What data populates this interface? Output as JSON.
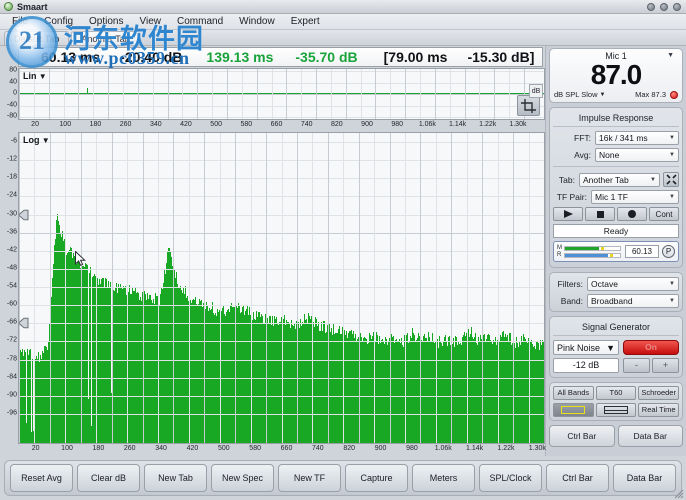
{
  "window": {
    "title": "Smaart",
    "controls": [
      "minimize",
      "maximize",
      "close"
    ]
  },
  "menubar": {
    "items": [
      "File",
      "Config",
      "Options",
      "View",
      "Command",
      "Window",
      "Expert"
    ]
  },
  "tabs": [
    {
      "label": "Default Tab",
      "active": false
    },
    {
      "label": "Another Tab",
      "active": true
    }
  ],
  "watermark": {
    "cn_text": "河东软件园",
    "url_text": "www.pc0359.cn",
    "logo_text": "21"
  },
  "readout": {
    "values": [
      {
        "text": "60.13 ms",
        "color": "#101216"
      },
      {
        "text": "-20.40 dB",
        "color": "#101216"
      },
      {
        "text": "139.13 ms",
        "color": "#19a33a"
      },
      {
        "text": "-35.70 dB",
        "color": "#19a33a"
      },
      {
        "text": "[79.00 ms",
        "color": "#101216"
      },
      {
        "text": "-15.30 dB]",
        "color": "#101216"
      }
    ]
  },
  "chart_data": [
    {
      "type": "line",
      "name": "impulse-response-linear",
      "title": "Lin",
      "xlabel": "",
      "ylabel": "",
      "ylim": [
        -80,
        80
      ],
      "yticks": [
        80,
        40,
        0,
        -40,
        -80
      ],
      "xticks": [
        "20",
        "100",
        "180",
        "260",
        "340",
        "420",
        "500",
        "580",
        "660",
        "740",
        "820",
        "900",
        "980",
        "1.06k",
        "1.14k",
        "1.22k",
        "1.30k"
      ],
      "grid": true,
      "trace_color": "#16a32f",
      "axis_unit_label": "dB",
      "values_note": "flat trace at 0 with small cursor tick near left"
    },
    {
      "type": "bar",
      "name": "spectrum-log",
      "title": "Log",
      "xlabel": "",
      "ylabel": "dB",
      "ylim": [
        -99,
        -3
      ],
      "yticks": [
        -6,
        -12,
        -18,
        -24,
        -30,
        -36,
        -42,
        -48,
        -54,
        -60,
        -66,
        -72,
        -78,
        -84,
        -90,
        -96
      ],
      "xticks": [
        "20",
        "100",
        "180",
        "260",
        "340",
        "420",
        "500",
        "580",
        "660",
        "740",
        "820",
        "900",
        "980",
        "1.06k",
        "1.14k",
        "1.22k",
        "1.30k"
      ],
      "grid": true,
      "bar_color": "#19a823",
      "markers": [
        -30,
        -66
      ],
      "categories": [
        "20",
        "28",
        "36",
        "44",
        "52",
        "60",
        "68",
        "76",
        "84",
        "92",
        "100",
        "108",
        "116",
        "124",
        "132",
        "140",
        "148",
        "156",
        "164",
        "172",
        "180",
        "188",
        "196",
        "204",
        "212",
        "220",
        "228",
        "236",
        "244",
        "252",
        "260",
        "300",
        "340",
        "380",
        "420",
        "460",
        "500",
        "540",
        "580",
        "620",
        "660",
        "700",
        "740",
        "780",
        "820",
        "860",
        "900",
        "940",
        "980",
        "1020",
        "1060",
        "1100",
        "1140",
        "1180",
        "1220",
        "1260",
        "1300"
      ],
      "values": [
        -70,
        -69,
        -71,
        -68,
        -24,
        -35,
        -38,
        -41,
        -44,
        -46,
        -47,
        -49,
        -48,
        -50,
        -51,
        -52,
        -34,
        -47,
        -50,
        -53,
        -54,
        -55,
        -56,
        -54,
        -55,
        -57,
        -58,
        -59,
        -58,
        -60,
        -59,
        -58,
        -60,
        -61,
        -62,
        -63,
        -64,
        -65,
        -64,
        -66,
        -65,
        -66,
        -63,
        -65,
        -64,
        -66,
        -65,
        -66,
        -62,
        -65,
        -64,
        -66,
        -63,
        -66,
        -65,
        -66,
        -67
      ]
    }
  ],
  "spl_meter": {
    "source": "Mic 1",
    "value": "87.0",
    "weighting": "dB SPL Slow",
    "max_label": "Max",
    "max_value": "87.3",
    "led_color": "#d91414"
  },
  "impulse_response": {
    "title": "Impulse Response",
    "fft_label": "FFT:",
    "fft_value": "16k / 341 ms",
    "avg_label": "Avg:",
    "avg_value": "None",
    "tab_label": "Tab:",
    "tab_value": "Another Tab",
    "tools_icon": "wrench-icon",
    "tf_pair_label": "TF Pair:",
    "tf_pair_value": "Mic 1 TF",
    "transport": [
      "play-icon",
      "stop-icon",
      "record-icon",
      "Cont"
    ],
    "status": "Ready",
    "meters": [
      {
        "name": "M",
        "level": 62,
        "peak": 66,
        "color": "#1ea52a"
      },
      {
        "name": "R",
        "level": 78,
        "peak": 82,
        "color": "#4f8fd6"
      }
    ],
    "delay_value": "60.13",
    "peak_button": "P",
    "filters_label": "Filters:",
    "filters_value": "Octave",
    "band_label": "Band:",
    "band_value": "Broadband"
  },
  "signal_generator": {
    "title": "Signal Generator",
    "source": "Pink Noise",
    "on_button": "On",
    "on_color": "#c50d0d",
    "level": "-12 dB",
    "minus": "-",
    "plus": "+"
  },
  "view_controls": {
    "buttons": [
      "All Bands",
      "T60",
      "Schroeder"
    ],
    "icon_buttons": [
      "bandwidth-rect-icon",
      "striped-rect-icon"
    ],
    "real_time": "Real Time"
  },
  "bar_toggles": {
    "ctrl_bar": "Ctrl Bar",
    "data_bar": "Data Bar"
  },
  "bottom_bar": {
    "buttons": [
      "Reset Avg",
      "Clear dB",
      "New Tab",
      "New Spec",
      "New TF",
      "Capture",
      "Meters",
      "SPL/Clock",
      "Ctrl Bar",
      "Data Bar"
    ]
  }
}
